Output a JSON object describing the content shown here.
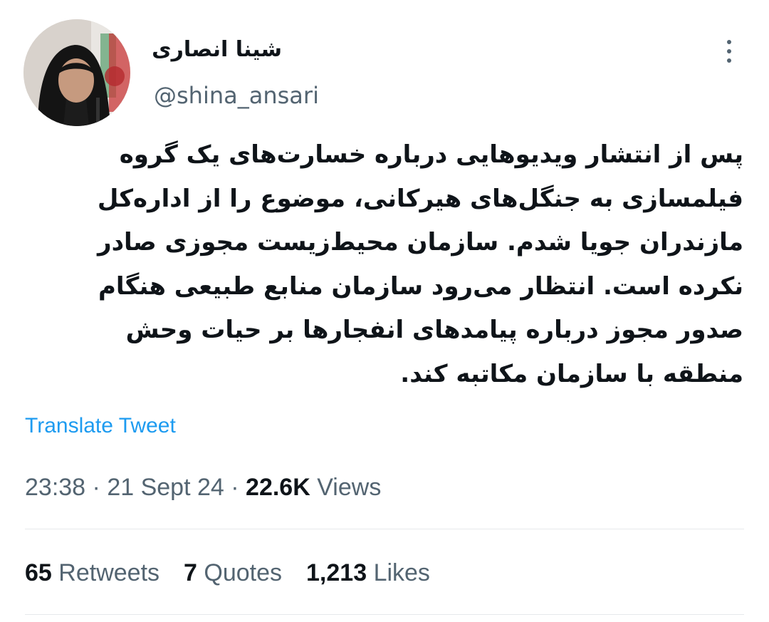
{
  "author": {
    "display_name": "شینا انصاری",
    "handle": "@shina_ansari",
    "avatar_icon": "user-avatar-photo"
  },
  "menu": {
    "icon": "more-vertical-icon"
  },
  "tweet": {
    "text": "پس از انتشار ویدیوهایی درباره خسارت‌های یک گروه\nفیلمسازی به جنگل‌های هیرکانی، موضوع را از اداره‌کل\nمازندران جویا شدم. سازمان محیط‌زیست مجوزی صادر\nنکرده است. انتظار می‌رود سازمان منابع طبیعی هنگام\nصدور مجوز درباره پیامدهای انفجارها بر حیات وحش\nمنطقه با سازمان مکاتبه کند.",
    "translate_label": "Translate Tweet"
  },
  "meta": {
    "time": "23:38",
    "date": "21 Sept 24",
    "separator": "·",
    "views_count": "22.6K",
    "views_label": "Views"
  },
  "stats": {
    "retweets_count": "65",
    "retweets_label": "Retweets",
    "quotes_count": "7",
    "quotes_label": "Quotes",
    "likes_count": "1,213",
    "likes_label": "Likes"
  },
  "colors": {
    "link": "#1d9bf0",
    "secondary_text": "#536471",
    "primary_text": "#0f1419",
    "divider": "#e6e9eb"
  }
}
